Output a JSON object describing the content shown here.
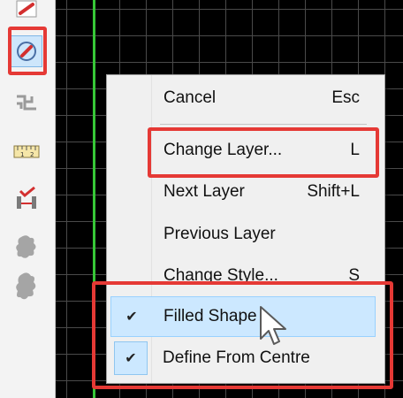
{
  "toolbar": {
    "tools": [
      {
        "name": "draw-shape-tool",
        "icon": "eraser-icon",
        "selected": false
      },
      {
        "name": "filled-shape-tool",
        "icon": "no-entry-circle-icon",
        "selected": true
      },
      {
        "name": "connector-tool",
        "icon": "circuit-icon",
        "selected": false
      },
      {
        "name": "measure-tool",
        "icon": "ruler-icon",
        "selected": false
      },
      {
        "name": "dimension-tool",
        "icon": "dimension-check-icon",
        "selected": false
      },
      {
        "name": "cloud-tool",
        "icon": "cloud-blob-icon",
        "selected": false
      },
      {
        "name": "cloud-tool-2",
        "icon": "cloud-blob-icon",
        "selected": false
      }
    ]
  },
  "menu": {
    "items": [
      {
        "label": "Cancel",
        "shortcut": "Esc"
      },
      {
        "label": "Change Layer...",
        "shortcut": "L"
      },
      {
        "label": "Next Layer",
        "shortcut": "Shift+L"
      },
      {
        "label": "Previous Layer",
        "shortcut": ""
      },
      {
        "label": "Change Style...",
        "shortcut": "S"
      },
      {
        "label": "Filled Shape",
        "shortcut": "",
        "checked": true,
        "highlighted": true
      },
      {
        "label": "Define From Centre",
        "shortcut": "",
        "checked": true
      }
    ],
    "check_glyph": "✔"
  },
  "colors": {
    "annotation_red": "#e53935",
    "menu_highlight": "#cce8ff",
    "canvas_bg": "#000000",
    "grid_line": "#4a4a4a",
    "green_line": "#37c837"
  }
}
